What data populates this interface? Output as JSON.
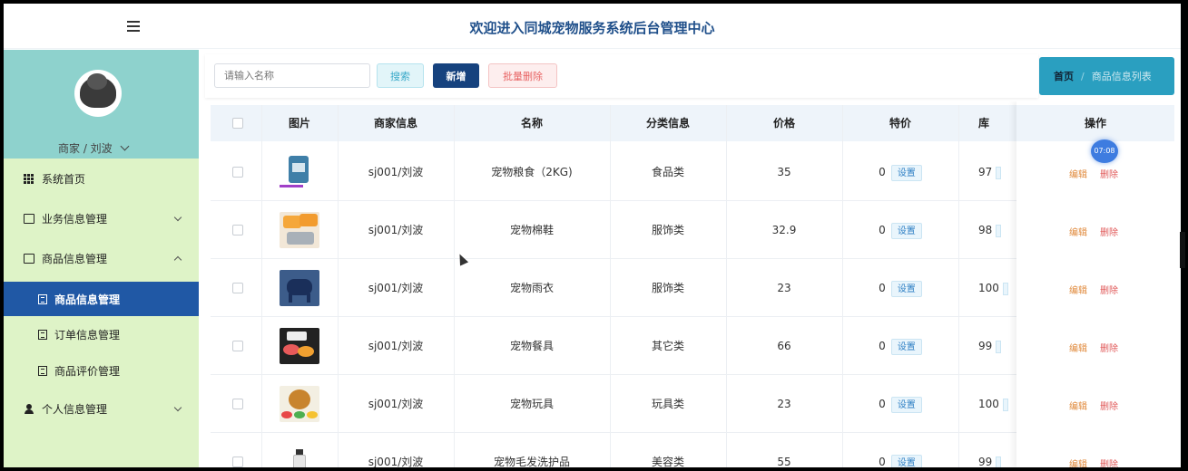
{
  "header": {
    "title": "欢迎进入同城宠物服务系统后台管理中心"
  },
  "sidebar": {
    "user_label": "商家 / 刘波",
    "items": [
      {
        "label": "系统首页",
        "icon": "grid-icon"
      },
      {
        "label": "业务信息管理",
        "icon": "folder-icon"
      },
      {
        "label": "商品信息管理",
        "icon": "folder-open-icon"
      },
      {
        "label": "商品信息管理",
        "icon": "document-icon"
      },
      {
        "label": "订单信息管理",
        "icon": "document-icon"
      },
      {
        "label": "商品评价管理",
        "icon": "document-icon"
      },
      {
        "label": "个人信息管理",
        "icon": "user-icon"
      }
    ]
  },
  "toolbar": {
    "search_placeholder": "请输入名称",
    "search_label": "搜索",
    "add_label": "新增",
    "batch_delete_label": "批量删除"
  },
  "breadcrumb": {
    "home": "首页",
    "separator": "/",
    "current": "商品信息列表"
  },
  "table": {
    "headers": {
      "image": "图片",
      "merchant": "商家信息",
      "name": "名称",
      "category": "分类信息",
      "price": "价格",
      "special": "特价",
      "stock": "库",
      "ops": "操作"
    },
    "set_label": "设置",
    "edit_label": "编辑",
    "delete_label": "删除",
    "rows": [
      {
        "merchant": "sj001/刘波",
        "name": "宠物粮食（2KG)",
        "category": "食品类",
        "price": "35",
        "special": "0",
        "stock": "97"
      },
      {
        "merchant": "sj001/刘波",
        "name": "宠物棉鞋",
        "category": "服饰类",
        "price": "32.9",
        "special": "0",
        "stock": "98"
      },
      {
        "merchant": "sj001/刘波",
        "name": "宠物雨衣",
        "category": "服饰类",
        "price": "23",
        "special": "0",
        "stock": "100"
      },
      {
        "merchant": "sj001/刘波",
        "name": "宠物餐具",
        "category": "其它类",
        "price": "66",
        "special": "0",
        "stock": "99"
      },
      {
        "merchant": "sj001/刘波",
        "name": "宠物玩具",
        "category": "玩具类",
        "price": "23",
        "special": "0",
        "stock": "100"
      },
      {
        "merchant": "sj001/刘波",
        "name": "宠物毛发洗护品",
        "category": "美容类",
        "price": "55",
        "special": "0",
        "stock": "99"
      }
    ]
  },
  "badge": {
    "time": "07:08"
  },
  "colors": {
    "sidebar_bg": "#def3c7",
    "profile_bg": "#8ed2cd",
    "active_menu": "#2058a5",
    "title": "#1f4f8a",
    "breadcrumb_bg": "#2a9fc0"
  }
}
